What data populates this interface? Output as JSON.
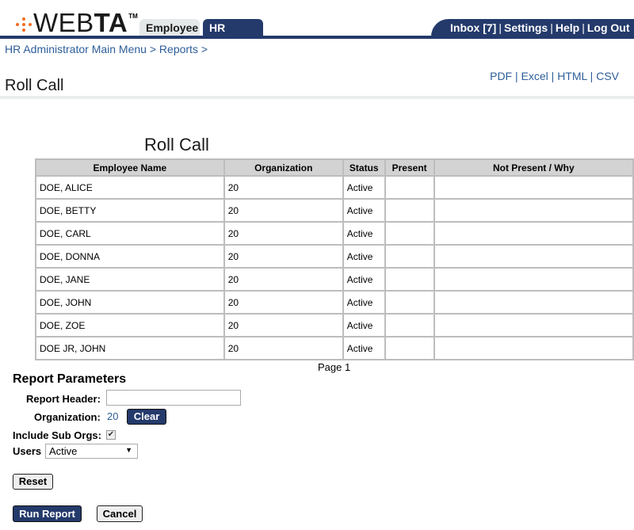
{
  "header": {
    "logo_text_light": "WEB",
    "logo_text_bold": "TA",
    "logo_tm": "TM",
    "tabs": [
      {
        "label": "Employee",
        "active": false
      },
      {
        "label": "HR Admin",
        "active": true
      }
    ],
    "util_links": [
      {
        "label": "Inbox [7]"
      },
      {
        "label": "Settings"
      },
      {
        "label": "Help"
      },
      {
        "label": "Log Out"
      }
    ],
    "separator": "|"
  },
  "breadcrumb": {
    "items": [
      "HR Administrator Main Menu",
      "Reports"
    ],
    "separator": ">"
  },
  "page": {
    "title": "Roll Call",
    "export_links": [
      "PDF",
      "Excel",
      "HTML",
      "CSV"
    ]
  },
  "report": {
    "title": "Roll Call",
    "columns": [
      "Employee Name",
      "Organization",
      "Status",
      "Present",
      "Not Present / Why"
    ],
    "rows": [
      {
        "name": "DOE, ALICE",
        "org": "20",
        "status": "Active",
        "present": "",
        "why": ""
      },
      {
        "name": "DOE, BETTY",
        "org": "20",
        "status": "Active",
        "present": "",
        "why": ""
      },
      {
        "name": "DOE, CARL",
        "org": "20",
        "status": "Active",
        "present": "",
        "why": ""
      },
      {
        "name": "DOE, DONNA",
        "org": "20",
        "status": "Active",
        "present": "",
        "why": ""
      },
      {
        "name": "DOE, JANE",
        "org": "20",
        "status": "Active",
        "present": "",
        "why": ""
      },
      {
        "name": "DOE, JOHN",
        "org": "20",
        "status": "Active",
        "present": "",
        "why": ""
      },
      {
        "name": "DOE, ZOE",
        "org": "20",
        "status": "Active",
        "present": "",
        "why": ""
      },
      {
        "name": "DOE JR, JOHN",
        "org": "20",
        "status": "Active",
        "present": "",
        "why": ""
      }
    ],
    "page_label": "Page 1"
  },
  "params": {
    "title": "Report Parameters",
    "report_header_label": "Report Header:",
    "report_header_value": "",
    "organization_label": "Organization:",
    "organization_value": "20",
    "clear_label": "Clear",
    "include_sub_orgs_label": "Include Sub Orgs:",
    "include_sub_orgs_checked": true,
    "check_glyph": "✔",
    "users_label": "Users",
    "users_selected": "Active",
    "users_arrow": "▼",
    "reset_label": "Reset",
    "run_report_label": "Run Report",
    "cancel_label": "Cancel"
  },
  "colors": {
    "brand_navy": "#243a6b",
    "link_blue": "#2d5e9a",
    "logo_orange": "#f26b21"
  }
}
